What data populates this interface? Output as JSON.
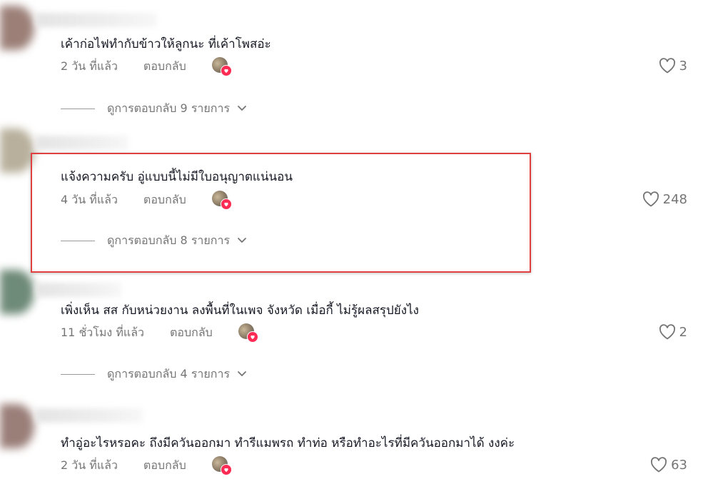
{
  "comments": [
    {
      "text": "เค้าก่อไฟทำกับข้าวให้ลูกนะ ที่เค้าโพสอ่ะ",
      "time": "2 วัน ที่แล้ว",
      "reply": "ตอบกลับ",
      "likes": "3",
      "view_replies": "ดูการตอบกลับ 9 รายการ",
      "avatar_color": "#9c8078"
    },
    {
      "text": "แจ้งความครับ อู่แบบนี้ไม่มีใบอนุญาตแน่นอน",
      "time": "4 วัน ที่แล้ว",
      "reply": "ตอบกลับ",
      "likes": "248",
      "view_replies": "ดูการตอบกลับ 8 รายการ",
      "avatar_color": "#b8b09c"
    },
    {
      "text": "เพิ่งเห็น สส กับหน่วยงาน ลงพื้นที่ในเพจ จังหวัด เมื่อกี้ ไม่รู้ผลสรุปยังไง",
      "time": "11 ชั่วโมง ที่แล้ว",
      "reply": "ตอบกลับ",
      "likes": "2",
      "view_replies": "ดูการตอบกลับ 4 รายการ",
      "avatar_color": "#6e8a78"
    },
    {
      "text": "ทำอู่อะไรหรอคะ ถึงมีควันออกมา ทำรีแมพรถ ทำท่อ หรือทำอะไรที่มีควันออกมาได้ งงค่ะ",
      "time": "2 วัน ที่แล้ว",
      "reply": "ตอบกลับ",
      "likes": "63",
      "avatar_color": "#9a7e78"
    }
  ],
  "colors": {
    "highlight": "#e04040",
    "like_heart": "#fe2c55",
    "meta_text": "#757575"
  },
  "icons": {
    "like": "heart-outline-icon",
    "expand": "chevron-down-icon",
    "liked_by_creator": "heart-filled-icon"
  }
}
